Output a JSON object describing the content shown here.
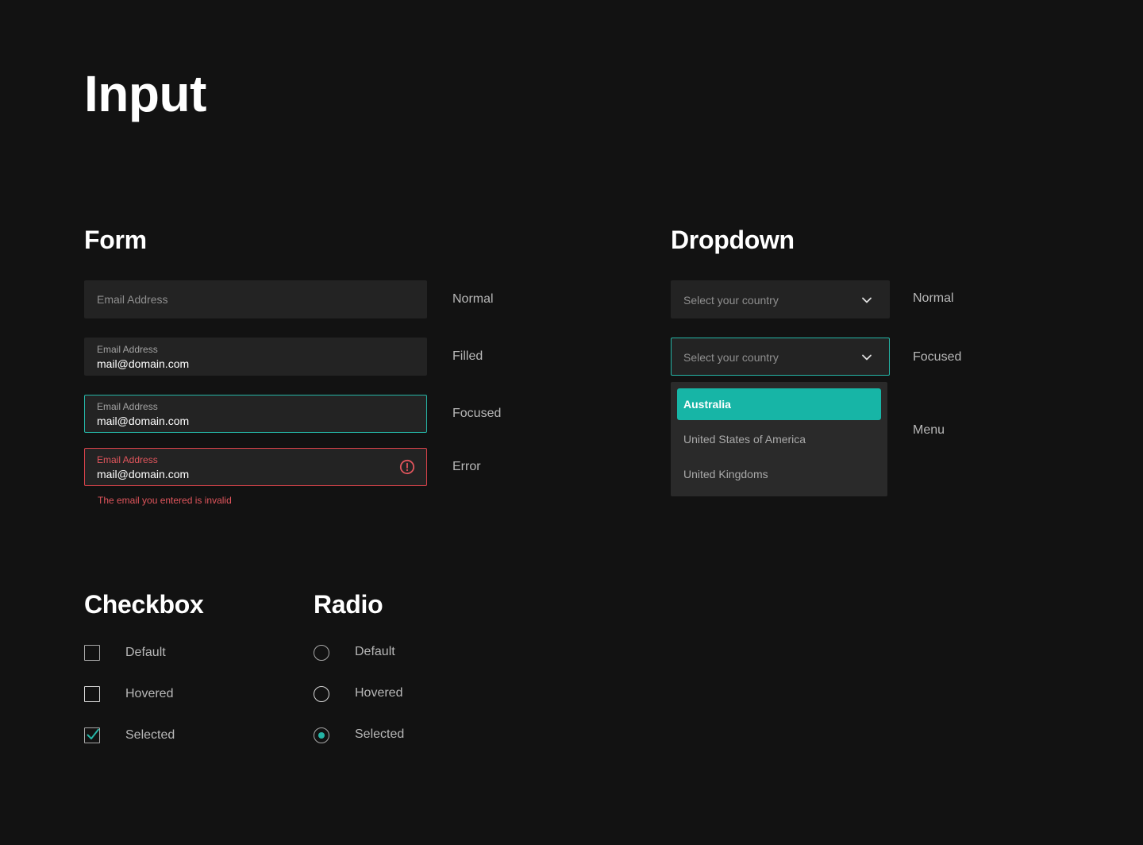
{
  "page": {
    "title": "Input"
  },
  "colors": {
    "background": "#121212",
    "accent": "#25b5a6",
    "error": "#d9424a",
    "field": "#232323"
  },
  "form": {
    "title": "Form",
    "normal": {
      "placeholder": "Email Address",
      "state": "Normal"
    },
    "filled": {
      "label": "Email Address",
      "value": "mail@domain.com",
      "state": "Filled"
    },
    "focused": {
      "label": "Email Address",
      "value": "mail@domain.com",
      "state": "Focused"
    },
    "error": {
      "label": "Email Address",
      "value": "mail@domain.com",
      "state": "Error",
      "message": "The email you entered is invalid",
      "icon": "alert-circle-icon"
    }
  },
  "dropdown": {
    "title": "Dropdown",
    "normal": {
      "placeholder": "Select your country",
      "state": "Normal",
      "icon": "chevron-down-icon"
    },
    "focused": {
      "placeholder": "Select your country",
      "state": "Focused",
      "icon": "chevron-down-icon"
    },
    "menu": {
      "state": "Menu",
      "items": [
        "Australia",
        "United States of America",
        "United Kingdoms"
      ],
      "selected_index": 0
    }
  },
  "checkbox": {
    "title": "Checkbox",
    "items": [
      {
        "label": "Default",
        "checked": false
      },
      {
        "label": "Hovered",
        "checked": false
      },
      {
        "label": "Selected",
        "checked": true
      }
    ]
  },
  "radio": {
    "title": "Radio",
    "items": [
      {
        "label": "Default",
        "selected": false
      },
      {
        "label": "Hovered",
        "selected": false
      },
      {
        "label": "Selected",
        "selected": true
      }
    ]
  }
}
